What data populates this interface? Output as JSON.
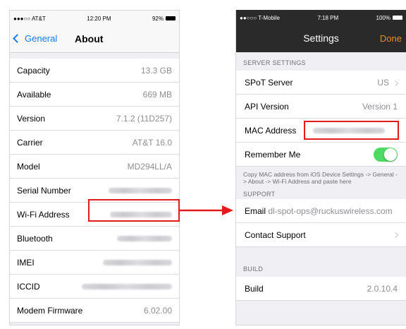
{
  "left": {
    "status": {
      "carrier": "●●●○○ AT&T",
      "time": "12:20 PM",
      "battery": "92%"
    },
    "nav": {
      "back": "General",
      "title": "About"
    },
    "rows": [
      {
        "label": "Capacity",
        "value": "13.3 GB"
      },
      {
        "label": "Available",
        "value": "669 MB"
      },
      {
        "label": "Version",
        "value": "7.1.2 (11D257)"
      },
      {
        "label": "Carrier",
        "value": "AT&T 16.0"
      },
      {
        "label": "Model",
        "value": "MD294LL/A"
      },
      {
        "label": "Serial Number",
        "value": ""
      },
      {
        "label": "Wi-Fi Address",
        "value": ""
      },
      {
        "label": "Bluetooth",
        "value": ""
      },
      {
        "label": "IMEI",
        "value": ""
      },
      {
        "label": "ICCID",
        "value": ""
      },
      {
        "label": "Modem Firmware",
        "value": "6.02.00"
      }
    ]
  },
  "right": {
    "status": {
      "carrier": "●●○○○ T-Mobile",
      "time": "7:18 PM",
      "battery": "100%"
    },
    "nav": {
      "title": "Settings",
      "done": "Done"
    },
    "sections": {
      "server": "SERVER SETTINGS",
      "support": "SUPPORT",
      "build": "BUILD"
    },
    "server_rows": [
      {
        "label": "SPoT Server",
        "value": "US"
      },
      {
        "label": "API Version",
        "value": "Version 1"
      },
      {
        "label": "MAC Address",
        "value": ""
      },
      {
        "label": "Remember Me",
        "value": ""
      }
    ],
    "note": "Copy MAC address from iOS Device Settings -> General -> About -> Wi-Fi Address and paste here",
    "support_rows": [
      {
        "label": "Email",
        "value": "dl-spot-ops@ruckuswireless.com"
      },
      {
        "label": "Contact Support",
        "value": ""
      }
    ],
    "build_rows": [
      {
        "label": "Build",
        "value": "2.0.10.4"
      }
    ]
  },
  "colors": {
    "accent_blue": "#1979ff",
    "accent_orange": "#f08a1f",
    "highlight_red": "#e31b1b",
    "toggle_green": "#4cd964"
  }
}
